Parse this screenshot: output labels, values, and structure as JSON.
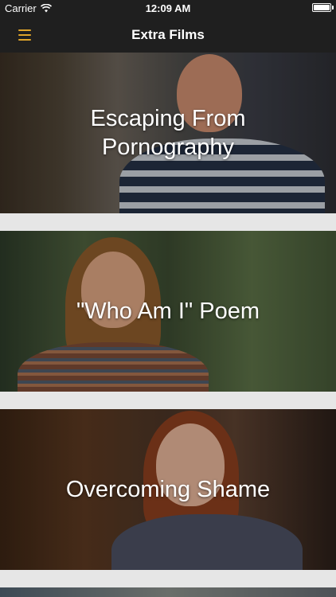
{
  "status_bar": {
    "carrier": "Carrier",
    "time": "12:09 AM",
    "wifi_icon": "wifi-icon",
    "battery_icon": "battery-icon"
  },
  "nav": {
    "title": "Extra Films",
    "menu_icon": "hamburger-menu-icon",
    "accent_color": "#e0a52a"
  },
  "films": [
    {
      "title": "Escaping From Pornography"
    },
    {
      "title": "\"Who Am I\" Poem"
    },
    {
      "title": "Overcoming Shame"
    }
  ]
}
